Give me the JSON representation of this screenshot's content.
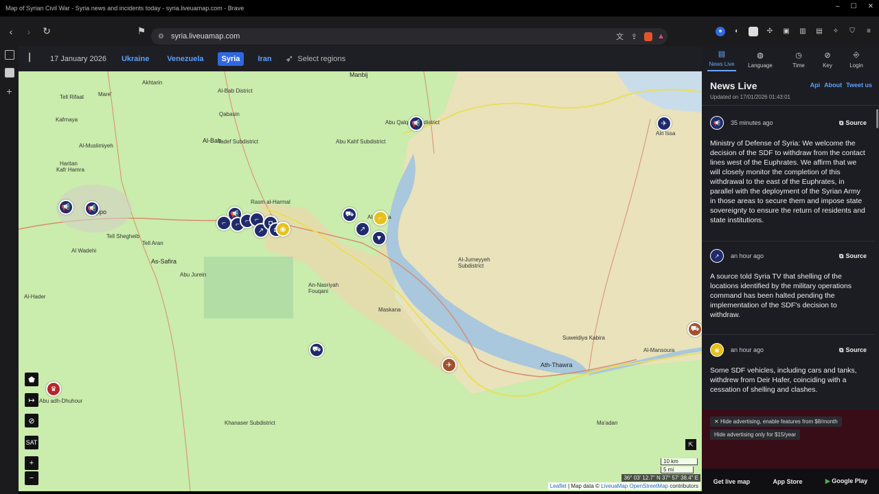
{
  "browser": {
    "window_title": "Map of Syrian Civil War - Syria news and incidents today - syria.liveuamap.com - Brave",
    "url": "syria.liveuamap.com"
  },
  "header": {
    "date": "17 January 2026",
    "regions": [
      {
        "label": "Ukraine",
        "selected": false
      },
      {
        "label": "Venezuela",
        "selected": false
      },
      {
        "label": "Syria",
        "selected": true
      },
      {
        "label": "Iran",
        "selected": false
      }
    ],
    "select_regions": "Select regions"
  },
  "right_nav": [
    {
      "label": "News Live",
      "icon": "news-icon",
      "selected": true
    },
    {
      "label": "Language",
      "icon": "globe-icon",
      "selected": false
    },
    {
      "label": "Time",
      "icon": "clock-icon",
      "selected": false
    },
    {
      "label": "Key",
      "icon": "compass-icon",
      "selected": false
    },
    {
      "label": "Login",
      "icon": "login-icon",
      "selected": false
    }
  ],
  "news": {
    "title": "News Live",
    "links": [
      "Api",
      "About",
      "Tweet us"
    ],
    "updated": "Updated on 17/01/2026 01:43:01",
    "source_label": "Source",
    "items": [
      {
        "time": "35 minutes ago",
        "icon": "megaphone-icon",
        "icon_color": "#1f2b6c",
        "text": "Ministry of Defense of Syria: We welcome the decision of the SDF to withdraw from the contact lines west of the Euphrates. We affirm that we will closely monitor the completion of this withdrawal to the east of the Euphrates, in parallel with the deployment of the Syrian Army in those areas to secure them and impose state sovereignty to ensure the return of residents and state institutions."
      },
      {
        "time": "an hour ago",
        "icon": "shelling-icon",
        "icon_color": "#1f2b6c",
        "text": "A source told Syria TV that shelling of the locations identified by the military operations command has been halted pending the implementation of the SDF's decision to withdraw."
      },
      {
        "time": "an hour ago",
        "icon": "gold-marker-icon",
        "icon_color": "#e6c11c",
        "text": "Some SDF vehicles, including cars and tanks, withdrew from Deir Hafer, coinciding with a cessation of shelling and clashes."
      }
    ]
  },
  "ads": {
    "hide_monthly": "Hide advertising, enable features from $8/month",
    "hide_yearly": "Hide advertising only for $15/year"
  },
  "store": {
    "get_live_map": "Get live map",
    "app_store": "App Store",
    "google_play": "Google Play"
  },
  "map": {
    "scale_km": "10 km",
    "scale_mi": "5 mi",
    "coords": "36° 03' 12.7\" N 37° 57' 38.4\" E",
    "attribution_leaflet": "Leaflet",
    "attribution_mid": " | Map data © ",
    "attribution_lum": "LiveuaMap",
    "attribution_osm": "OpenStreetMap",
    "attribution_end": " contributors",
    "sat_label": "SAT",
    "places": [
      {
        "name": "Akhtarin",
        "big": false
      },
      {
        "name": "Mare'",
        "big": false
      },
      {
        "name": "Tell Rifaat",
        "big": false
      },
      {
        "name": "Kafrnaya",
        "big": false
      },
      {
        "name": "Al-Bab District",
        "big": false
      },
      {
        "name": "Qabasin",
        "big": false
      },
      {
        "name": "Al-Bab",
        "big": true
      },
      {
        "name": "Tadef Subdistrict",
        "big": false
      },
      {
        "name": "Al-Muslimiyeh",
        "big": false
      },
      {
        "name": "Haritan",
        "big": false
      },
      {
        "name": "Kafr Hamra",
        "big": false
      },
      {
        "name": "Aleppo",
        "big": true
      },
      {
        "name": "Tell Shegheib",
        "big": false
      },
      {
        "name": "Tell Aran",
        "big": false
      },
      {
        "name": "Al Wadehi",
        "big": false
      },
      {
        "name": "As-Safira",
        "big": true
      },
      {
        "name": "Abu Jurein",
        "big": false
      },
      {
        "name": "Al-Hader",
        "big": false
      },
      {
        "name": "Manbij",
        "big": false
      },
      {
        "name": "Rasm al-Harmal",
        "big": false
      },
      {
        "name": "Al-Khafsa",
        "big": false
      },
      {
        "name": "Abu Qalqal Subdistrict",
        "big": false
      },
      {
        "name": "Abu Kahf Subdistrict",
        "big": false
      },
      {
        "name": "An-Nasriyah Fouqani",
        "big": false
      },
      {
        "name": "Maskana",
        "big": false
      },
      {
        "name": "Ath-Thawra",
        "big": true
      },
      {
        "name": "Suweidiya Kabira",
        "big": false
      },
      {
        "name": "Al-Mansoura",
        "big": false
      },
      {
        "name": "Ain Issa",
        "big": false
      },
      {
        "name": "Al-Jurneyyeh Subdistrict",
        "big": false
      },
      {
        "name": "Khanaser Subdistrict",
        "big": false
      },
      {
        "name": "Abu adh-Dhuhour",
        "big": false
      },
      {
        "name": "Ma'adan",
        "big": false
      }
    ]
  }
}
